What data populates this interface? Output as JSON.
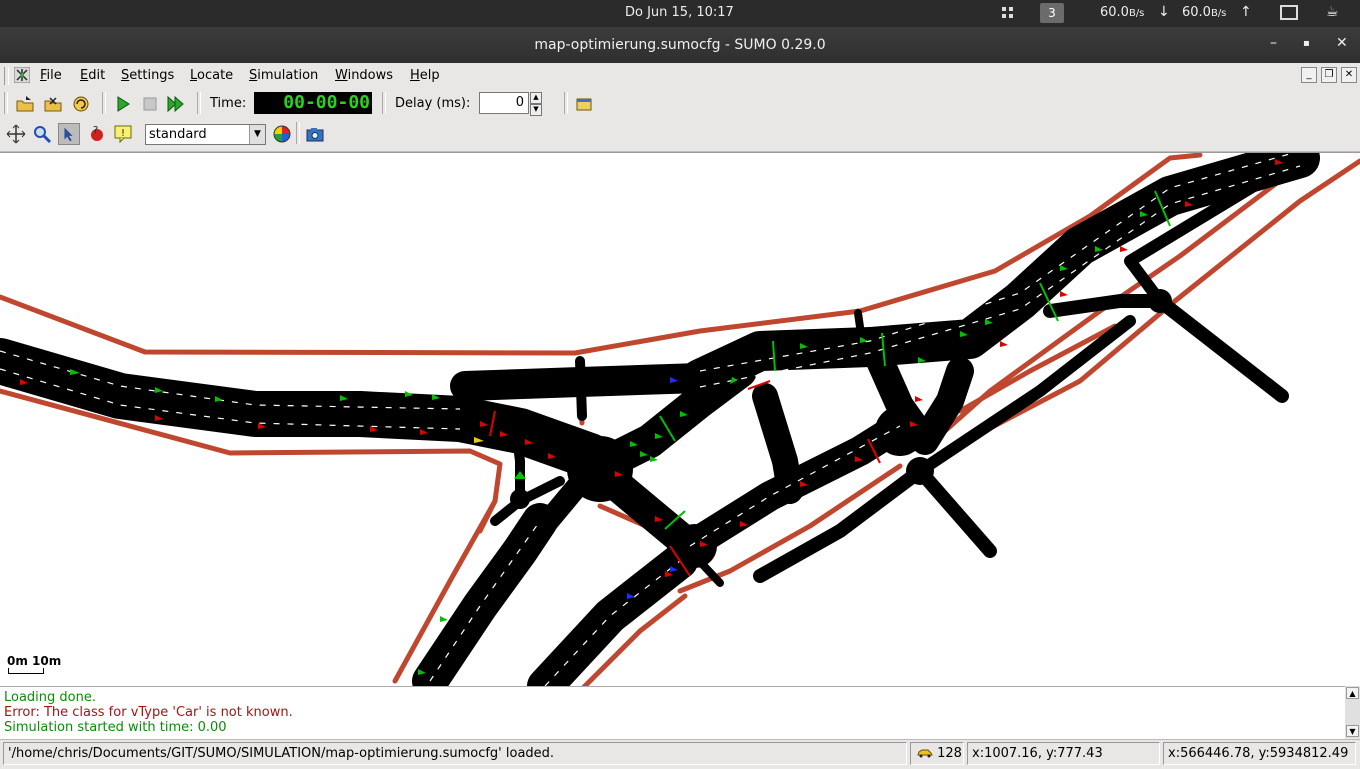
{
  "system_bar": {
    "clock": "Do Jun 15, 10:17",
    "workspace": "3",
    "net_up_value": "60.0",
    "net_up_unit": "B/s",
    "net_down_value": "60.0",
    "net_down_unit": "B/s",
    "icons": [
      "apps-grid-icon",
      "arrow-down-icon",
      "arrow-up-icon",
      "monitor-icon",
      "coffee-cup-icon"
    ]
  },
  "window": {
    "title": "map-optimierung.sumocfg - SUMO 0.29.0",
    "minimize": "–",
    "maximize": "▪",
    "close": "✕"
  },
  "menu": {
    "items": [
      {
        "label": "File",
        "underline": "F",
        "rest": "ile"
      },
      {
        "label": "Edit",
        "underline": "E",
        "rest": "dit"
      },
      {
        "label": "Settings",
        "underline": "S",
        "rest": "ettings"
      },
      {
        "label": "Locate",
        "underline": "L",
        "rest": "ocate"
      },
      {
        "label": "Simulation",
        "underline": "S",
        "rest": "imulation"
      },
      {
        "label": "Windows",
        "underline": "W",
        "rest": "indows"
      },
      {
        "label": "Help",
        "underline": "H",
        "rest": "elp"
      }
    ]
  },
  "toolbar": {
    "time_label": "Time:",
    "time_value": "00-00-00",
    "delay_label": "Delay (ms):",
    "delay_value": "0",
    "scheme": "standard",
    "icons": [
      "open-config-icon",
      "open-network-icon",
      "reload-icon",
      "run-icon",
      "stop-icon",
      "step-icon",
      "edit-breakpoints-icon",
      "recenter-icon",
      "zoom-icon",
      "select-mode-icon",
      "locate-icon",
      "tooltip-icon",
      "color-wheel-icon",
      "screenshot-icon"
    ]
  },
  "map": {
    "scale_text": "0m 10m",
    "colors": {
      "road": "#000000",
      "sidewalk": "#c0472f",
      "green": "#00c000",
      "red": "#e00000",
      "blue": "#1d2fff",
      "background": "#ffffff"
    }
  },
  "log": {
    "lines": [
      {
        "text": "Loading done.",
        "color": "#0d8a0d"
      },
      {
        "text": "Error: The class for vType 'Car' is not known.",
        "color": "#a31515"
      },
      {
        "text": "Simulation started with time: 0.00",
        "color": "#0d8a0d"
      }
    ]
  },
  "status": {
    "message": "'/home/chris/Documents/GIT/SUMO/SIMULATION/map-optimierung.sumocfg' loaded.",
    "vehicle_count": "128",
    "cursor_pos": "x:1007.16, y:777.43",
    "geo_pos": "x:566446.78, y:5934812.49"
  }
}
